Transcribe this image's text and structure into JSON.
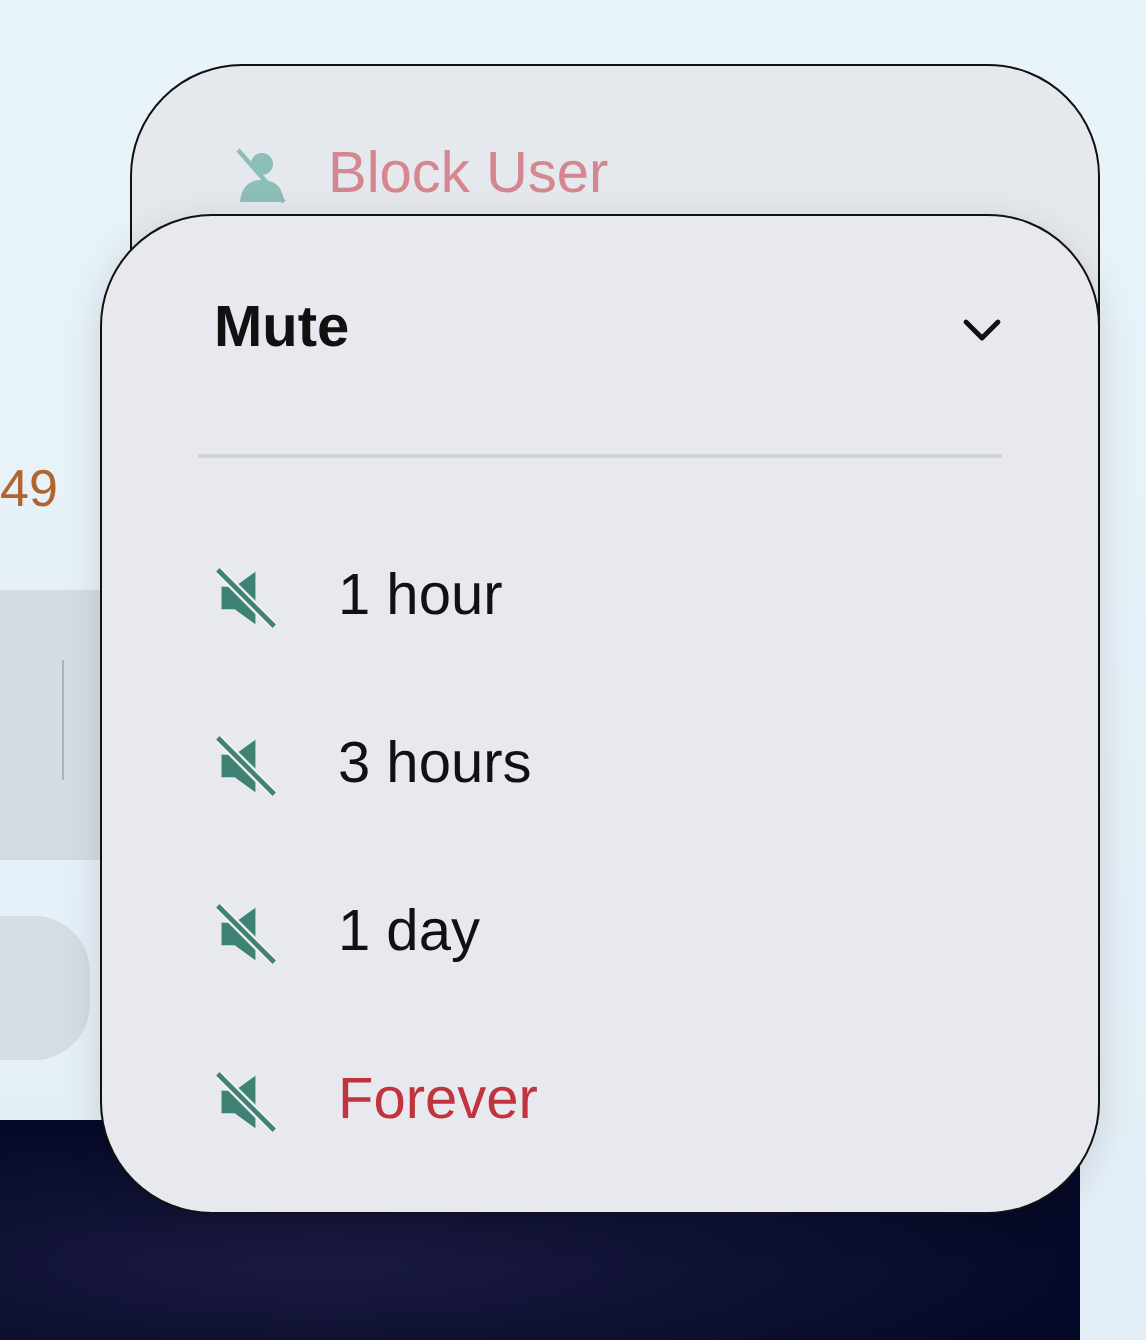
{
  "background": {
    "count": "49"
  },
  "block_menu": {
    "items": [
      {
        "label": "Block User",
        "kind": "danger"
      }
    ]
  },
  "mute_menu": {
    "title": "Mute",
    "expanded": true,
    "options": [
      {
        "label": "1 hour",
        "kind": "normal"
      },
      {
        "label": "3 hours",
        "kind": "normal"
      },
      {
        "label": "1 day",
        "kind": "normal"
      },
      {
        "label": "Forever",
        "kind": "danger"
      }
    ]
  }
}
